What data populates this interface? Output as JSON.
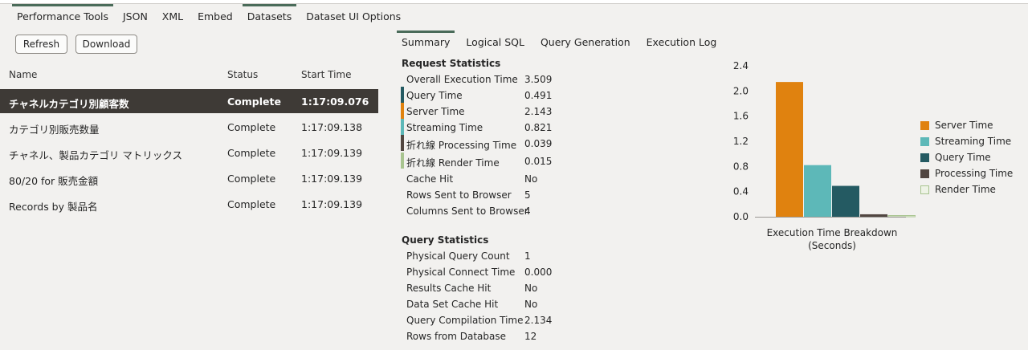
{
  "top_tabs": [
    "Performance Tools",
    "JSON",
    "XML",
    "Embed",
    "Datasets",
    "Dataset UI Options"
  ],
  "toolbar": {
    "refresh_label": "Refresh",
    "download_label": "Download"
  },
  "table": {
    "headers": {
      "name": "Name",
      "status": "Status",
      "start": "Start Time"
    },
    "rows": [
      {
        "name": "チャネルカテゴリ別顧客数",
        "status": "Complete",
        "start": "1:17:09.076"
      },
      {
        "name": "カテゴリ別販売数量",
        "status": "Complete",
        "start": "1:17:09.138"
      },
      {
        "name": "チャネル、製品カテゴリ マトリックス",
        "status": "Complete",
        "start": "1:17:09.139"
      },
      {
        "name": "80/20 for 販売金額",
        "status": "Complete",
        "start": "1:17:09.139"
      },
      {
        "name": "Records by 製品名",
        "status": "Complete",
        "start": "1:17:09.139"
      }
    ]
  },
  "sub_tabs": [
    "Summary",
    "Logical SQL",
    "Query Generation",
    "Execution Log"
  ],
  "request_statistics": {
    "title": "Request Statistics",
    "items": [
      {
        "label": "Overall Execution Time",
        "value": "3.509"
      },
      {
        "label": "Query Time",
        "value": "0.491"
      },
      {
        "label": "Server Time",
        "value": "2.143"
      },
      {
        "label": "Streaming Time",
        "value": "0.821"
      },
      {
        "label": "折れ線 Processing Time",
        "value": "0.039"
      },
      {
        "label": "折れ線 Render Time",
        "value": "0.015"
      },
      {
        "label": "Cache Hit",
        "value": "No"
      },
      {
        "label": "Rows Sent to Browser",
        "value": "5"
      },
      {
        "label": "Columns Sent to Browser",
        "value": "4"
      }
    ]
  },
  "query_statistics": {
    "title": "Query Statistics",
    "items": [
      {
        "label": "Physical Query Count",
        "value": "1"
      },
      {
        "label": "Physical Connect Time",
        "value": "0.000"
      },
      {
        "label": "Results Cache Hit",
        "value": "No"
      },
      {
        "label": "Data Set Cache Hit",
        "value": "No"
      },
      {
        "label": "Query Compilation Time",
        "value": "2.134"
      },
      {
        "label": "Rows from Database",
        "value": "12"
      }
    ]
  },
  "colors": {
    "server": "#e0820f",
    "streaming": "#5db8b8",
    "query": "#245a62",
    "processing": "#514640",
    "render": "#eef3e6",
    "render_border": "#a8c48f",
    "accent": "#4a6b59",
    "selected_row": "#3e3a36"
  },
  "chart_data": {
    "type": "bar",
    "title": "Execution Time Breakdown\n(Seconds)",
    "categories": [
      "Server Time",
      "Streaming Time",
      "Query Time",
      "Processing Time",
      "Render Time"
    ],
    "values": [
      2.143,
      0.821,
      0.491,
      0.039,
      0.015
    ],
    "ylim": [
      0,
      2.4
    ],
    "yticks": [
      "0.0",
      "0.4",
      "0.8",
      "1.2",
      "1.6",
      "2.0",
      "2.4"
    ],
    "legend": [
      "Server Time",
      "Streaming Time",
      "Query Time",
      "Processing Time",
      "Render Time"
    ],
    "legend_position": "right",
    "grid": false
  }
}
